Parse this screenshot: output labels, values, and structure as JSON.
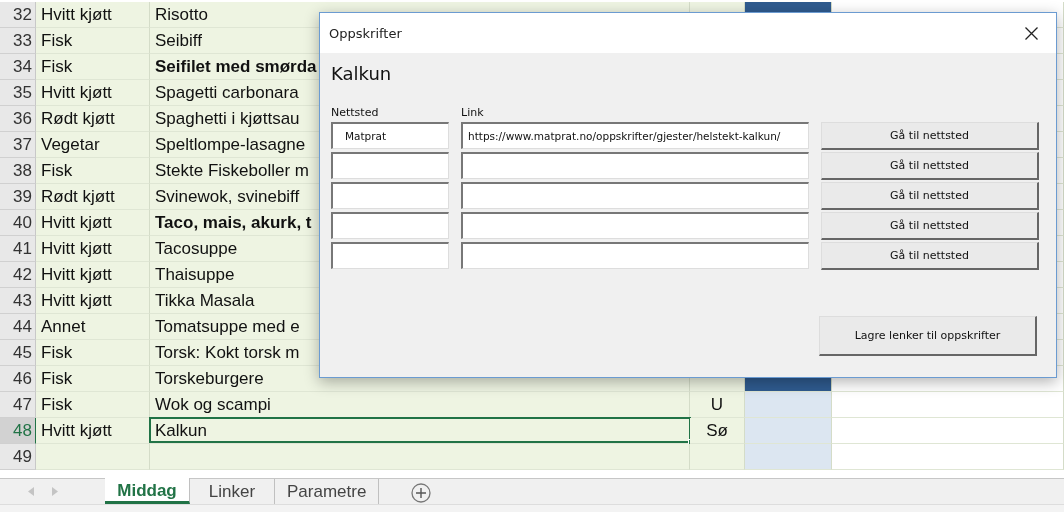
{
  "sheet": {
    "rows": [
      {
        "number": "32",
        "category": "Hvitt kjøtt",
        "dish": "Risotto",
        "bold": false,
        "band": true,
        "selected": false
      },
      {
        "number": "33",
        "category": "Fisk",
        "dish": "Seibiff",
        "bold": false,
        "selected": false
      },
      {
        "number": "34",
        "category": "Fisk",
        "dish": "Seifilet med smørda",
        "bold": true,
        "selected": false
      },
      {
        "number": "35",
        "category": "Hvitt kjøtt",
        "dish": "Spagetti carbonara",
        "bold": false,
        "selected": false
      },
      {
        "number": "36",
        "category": "Rødt kjøtt",
        "dish": "Spaghetti i kjøttsau",
        "bold": false,
        "selected": false
      },
      {
        "number": "37",
        "category": "Vegetar",
        "dish": "Speltlompe-lasagne",
        "bold": false,
        "selected": false
      },
      {
        "number": "38",
        "category": "Fisk",
        "dish": "Stekte Fiskeboller m",
        "bold": false,
        "selected": false
      },
      {
        "number": "39",
        "category": "Rødt kjøtt",
        "dish": "Svinewok, svinebiff",
        "bold": false,
        "selected": false
      },
      {
        "number": "40",
        "category": "Hvitt kjøtt",
        "dish": "Taco, mais, akurk, t",
        "bold": true,
        "selected": false
      },
      {
        "number": "41",
        "category": "Hvitt kjøtt",
        "dish": "Tacosuppe",
        "bold": false,
        "selected": false
      },
      {
        "number": "42",
        "category": "Hvitt kjøtt",
        "dish": "Thaisuppe",
        "bold": false,
        "selected": false
      },
      {
        "number": "43",
        "category": "Hvitt kjøtt",
        "dish": "Tikka Masala",
        "bold": false,
        "selected": false
      },
      {
        "number": "44",
        "category": "Annet",
        "dish": "Tomatsuppe med e",
        "bold": false,
        "selected": false
      },
      {
        "number": "45",
        "category": "Fisk",
        "dish": "Torsk: Kokt torsk m",
        "bold": false,
        "selected": false
      },
      {
        "number": "46",
        "category": "Fisk",
        "dish": "Torskeburgere",
        "bold": false,
        "band": true,
        "selected": false
      },
      {
        "number": "47",
        "category": "Fisk",
        "dish": "Wok og scampi",
        "code": "U",
        "bold": false,
        "band": false,
        "selected": false
      },
      {
        "number": "48",
        "category": "Hvitt kjøtt",
        "dish": "Kalkun",
        "code": "Sø",
        "bold": false,
        "band": false,
        "selected": true
      },
      {
        "number": "49",
        "band": false,
        "selected": false
      }
    ]
  },
  "dialog": {
    "title": "Oppskrifter",
    "heading": "Kalkun",
    "site_label": "Nettsted",
    "link_label": "Link",
    "links": [
      {
        "site": "Matprat",
        "url": "https://www.matprat.no/oppskrifter/gjester/helstekt-kalkun/",
        "button": "Gå til nettsted"
      },
      {
        "button": "Gå til nettsted"
      },
      {
        "button": "Gå til nettsted"
      },
      {
        "button": "Gå til nettsted"
      },
      {
        "button": "Gå til nettsted"
      }
    ],
    "save_button": "Lagre lenker til oppskrifter"
  },
  "sheet_tabs": [
    {
      "label": "Middag",
      "selected": true
    },
    {
      "label": "Linker",
      "selected": false
    },
    {
      "label": "Parametre",
      "selected": false
    }
  ]
}
